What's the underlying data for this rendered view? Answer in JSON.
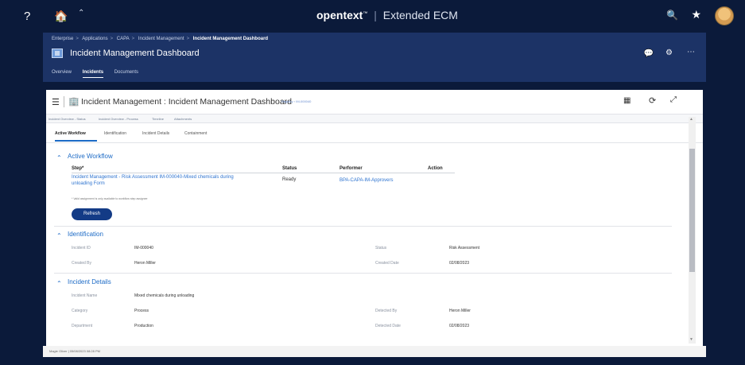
{
  "top": {
    "help": "?",
    "brand_name": "opentext",
    "brand_tm": "™",
    "brand_sep": "|",
    "brand_app": "Extended ECM"
  },
  "subheader": {
    "breadcrumbs": [
      "Enterprise",
      "Applications",
      "CAPA",
      "Incident Management"
    ],
    "breadcrumb_current": "Incident Management Dashboard",
    "title": "Incident Management Dashboard",
    "tabs": [
      "Overview",
      "Incidents",
      "Documents"
    ],
    "active_tab": "Incidents"
  },
  "panel": {
    "title": "Incident Management : Incident Management Dashboard",
    "registry": "Registry  › IM-000040",
    "subtabs": [
      "Incident Overview - Status",
      "Incident Overview - Process",
      "Timeline",
      "Attachments"
    ],
    "tabs": [
      "Active Workflow",
      "Identification",
      "Incident Details",
      "Containment"
    ],
    "active_tab": "Active Workflow"
  },
  "workflow": {
    "title": "Active Workflow",
    "col_step": "Step*",
    "col_status": "Status",
    "col_performer": "Performer",
    "col_action": "Action",
    "row_step_line1": "Incident Management - Risk Assessment IM-000040-Mixed chemicals during",
    "row_step_line2": "unloading Form",
    "row_status": "Ready",
    "row_performer": "BPA-CAPA-IM-Approvers",
    "note": "* Valid assignment is only available to workflow step assignee",
    "refresh": "Refresh"
  },
  "identification": {
    "title": "Identification",
    "incident_id_label": "Incident ID",
    "incident_id": "IM-000040",
    "status_label": "Status",
    "status": "Risk Assessment",
    "created_by_label": "Created By",
    "created_by": "Heron Miller",
    "created_date_label": "Created Date",
    "created_date": "02/08/2023"
  },
  "details": {
    "title": "Incident Details",
    "name_label": "Incident Name",
    "name": "Mixed chemicals during unloading",
    "category_label": "Category",
    "category": "Process",
    "detected_by_label": "Detected By",
    "detected_by": "Heron Miller",
    "department_label": "Department",
    "department": "Production",
    "detected_date_label": "Detected Date",
    "detected_date": "02/08/2023"
  },
  "footer": {
    "text": "Magie Oliver | 05/08/2023 08:28 PM"
  }
}
